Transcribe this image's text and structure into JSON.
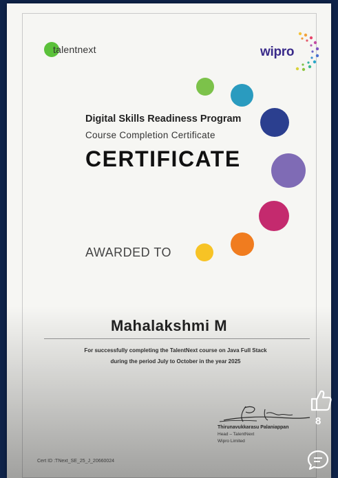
{
  "certificate": {
    "brand_left": "talentnext",
    "brand_right": "wipro",
    "program": "Digital Skills Readiness Program",
    "subtitle": "Course Completion Certificate",
    "title": "CERTIFICATE",
    "awarded_to": "AWARDED TO",
    "recipient": "Mahalakshmi M",
    "description_line1": "For successfully completing the TalentNext course on Java Full Stack",
    "description_line2": "during the period July to October in the year 2025",
    "signatory_name": "Thirunavukkarasu Palaniappan",
    "signatory_title": "Head – TalentNext",
    "signatory_org": "Wipro Limited",
    "cert_id": "Cert ID  :TNext_SE_25_J_20660024"
  },
  "overlay": {
    "like_count": "8"
  },
  "colors": {
    "dot_green": "#7cc24a",
    "dot_teal": "#2a9bbf",
    "dot_navy": "#2b3f8f",
    "dot_purple": "#7f6bb5",
    "dot_magenta": "#c42a6e",
    "dot_orange": "#f07c1f",
    "dot_yellow": "#f7c325",
    "viewer_background": "#0f2349"
  }
}
